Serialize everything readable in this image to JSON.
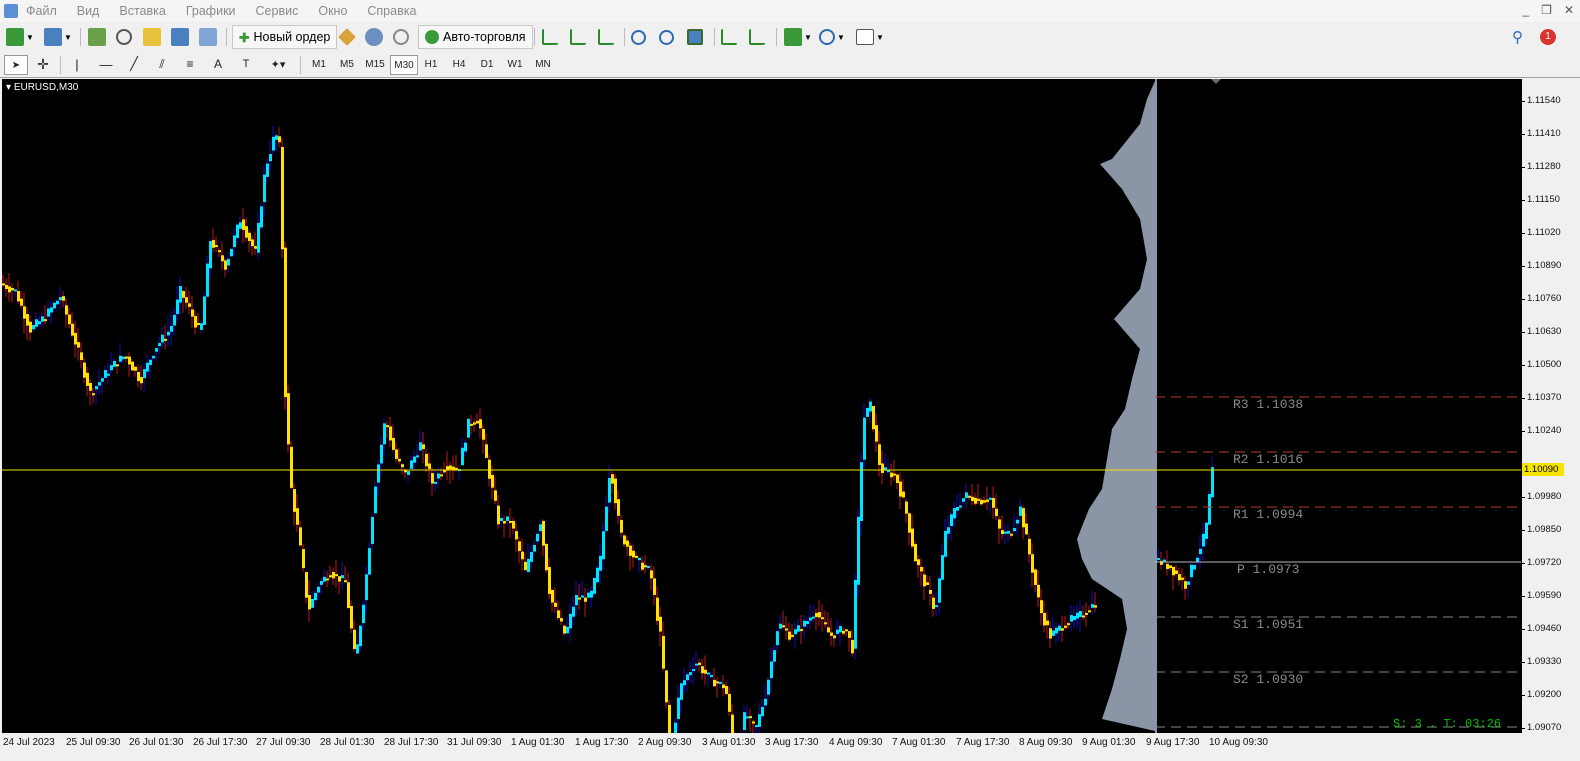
{
  "menu": [
    "Файл",
    "Вид",
    "Вставка",
    "Графики",
    "Сервис",
    "Окно",
    "Справка"
  ],
  "toolbar": {
    "new_order_label": "Новый ордер",
    "autotrade_label": "Авто-торговля",
    "notification_count": "1"
  },
  "timeframes": [
    "M1",
    "M5",
    "M15",
    "M30",
    "H1",
    "H4",
    "D1",
    "W1",
    "MN"
  ],
  "active_timeframe": "M30",
  "chart": {
    "symbol_label": "EURUSD,M30",
    "current_price": "1.10090",
    "status_text": "S: 3 . T: 03:26",
    "colors": {
      "background": "#000000",
      "up": "#00e5ff",
      "down": "#ffe000",
      "wick": "#1010c0",
      "volume_profile": "#8a96a6",
      "price_line": "#f0e000",
      "pivot_line_r": "#c0392b",
      "pivot_line_s": "#8a8a8a"
    }
  },
  "pivots": [
    {
      "name": "R3",
      "value": "1.1038",
      "label": "R3 1.1038"
    },
    {
      "name": "R2",
      "value": "1.1016",
      "label": "R2 1.1016"
    },
    {
      "name": "R1",
      "value": "1.0994",
      "label": "R1 1.0994"
    },
    {
      "name": "P",
      "value": "1.0973",
      "label": "P 1.0973"
    },
    {
      "name": "S1",
      "value": "1.0951",
      "label": "S1 1.0951"
    },
    {
      "name": "S2",
      "value": "1.0930",
      "label": "S2 1.0930"
    }
  ],
  "y_axis_labels": [
    "1.11540",
    "1.11410",
    "1.11280",
    "1.11150",
    "1.11020",
    "1.10890",
    "1.10760",
    "1.10630",
    "1.10500",
    "1.10370",
    "1.10240",
    "1.10090",
    "1.09980",
    "1.09850",
    "1.09720",
    "1.09590",
    "1.09460",
    "1.09330",
    "1.09200",
    "1.09070"
  ],
  "x_axis_labels": [
    "24 Jul 2023",
    "25 Jul 09:30",
    "26 Jul 01:30",
    "26 Jul 17:30",
    "27 Jul 09:30",
    "28 Jul 01:30",
    "28 Jul 17:30",
    "31 Jul 09:30",
    "1 Aug 01:30",
    "1 Aug 17:30",
    "2 Aug 09:30",
    "3 Aug 01:30",
    "3 Aug 17:30",
    "4 Aug 09:30",
    "7 Aug 01:30",
    "7 Aug 17:30",
    "8 Aug 09:30",
    "9 Aug 01:30",
    "9 Aug 17:30",
    "10 Aug 09:30"
  ],
  "chart_data": {
    "type": "candlestick",
    "symbol": "EURUSD",
    "timeframe": "M30",
    "ylim": [
      1.0907,
      1.1163
    ],
    "price_path": [
      [
        0,
        1.1083
      ],
      [
        15,
        1.108
      ],
      [
        30,
        1.1065
      ],
      [
        45,
        1.107
      ],
      [
        60,
        1.1078
      ],
      [
        75,
        1.106
      ],
      [
        90,
        1.104
      ],
      [
        100,
        1.1045
      ],
      [
        110,
        1.105
      ],
      [
        125,
        1.1055
      ],
      [
        140,
        1.1045
      ],
      [
        155,
        1.1058
      ],
      [
        170,
        1.1065
      ],
      [
        180,
        1.108
      ],
      [
        190,
        1.1072
      ],
      [
        200,
        1.1063
      ],
      [
        210,
        1.11
      ],
      [
        225,
        1.109
      ],
      [
        240,
        1.1108
      ],
      [
        255,
        1.1095
      ],
      [
        265,
        1.1128
      ],
      [
        275,
        1.1142
      ],
      [
        280,
        1.1135
      ],
      [
        285,
        1.104
      ],
      [
        290,
        1.1005
      ],
      [
        298,
        1.0985
      ],
      [
        308,
        1.0955
      ],
      [
        318,
        1.0965
      ],
      [
        330,
        1.097
      ],
      [
        345,
        1.0966
      ],
      [
        355,
        1.0935
      ],
      [
        365,
        1.0965
      ],
      [
        375,
        1.1005
      ],
      [
        385,
        1.103
      ],
      [
        395,
        1.1015
      ],
      [
        405,
        1.1008
      ],
      [
        420,
        1.102
      ],
      [
        432,
        1.1005
      ],
      [
        445,
        1.1012
      ],
      [
        458,
        1.101
      ],
      [
        468,
        1.1028
      ],
      [
        478,
        1.103
      ],
      [
        488,
        1.101
      ],
      [
        498,
        1.099
      ],
      [
        510,
        1.099
      ],
      [
        525,
        1.097
      ],
      [
        540,
        1.099
      ],
      [
        550,
        1.096
      ],
      [
        565,
        1.0945
      ],
      [
        575,
        1.096
      ],
      [
        590,
        1.096
      ],
      [
        600,
        1.0975
      ],
      [
        610,
        1.1012
      ],
      [
        620,
        1.0985
      ],
      [
        635,
        1.0975
      ],
      [
        650,
        1.097
      ],
      [
        660,
        1.0945
      ],
      [
        670,
        1.09
      ],
      [
        680,
        1.0925
      ],
      [
        695,
        1.0935
      ],
      [
        710,
        1.0928
      ],
      [
        725,
        1.0925
      ],
      [
        735,
        1.0898
      ],
      [
        745,
        1.0915
      ],
      [
        755,
        1.0908
      ],
      [
        765,
        1.0922
      ],
      [
        778,
        1.095
      ],
      [
        790,
        1.0945
      ],
      [
        805,
        1.095
      ],
      [
        815,
        1.0955
      ],
      [
        830,
        1.0945
      ],
      [
        845,
        1.0948
      ],
      [
        852,
        1.094
      ],
      [
        858,
        1.099
      ],
      [
        863,
        1.103
      ],
      [
        870,
        1.1035
      ],
      [
        880,
        1.101
      ],
      [
        895,
        1.1008
      ],
      [
        905,
        1.0995
      ],
      [
        915,
        1.0975
      ],
      [
        925,
        1.0965
      ],
      [
        935,
        1.0955
      ],
      [
        945,
        1.0985
      ],
      [
        955,
        1.0995
      ],
      [
        965,
        1.1
      ],
      [
        980,
        1.0998
      ],
      [
        990,
        1.0999
      ],
      [
        1000,
        1.0985
      ],
      [
        1010,
        1.0985
      ],
      [
        1020,
        1.0995
      ],
      [
        1030,
        1.0975
      ],
      [
        1040,
        1.0955
      ],
      [
        1050,
        1.0945
      ],
      [
        1065,
        1.095
      ],
      [
        1080,
        1.0953
      ],
      [
        1095,
        1.0958
      ],
      [
        1155,
        1.0975
      ],
      [
        1170,
        1.0972
      ],
      [
        1185,
        1.0965
      ],
      [
        1195,
        1.0975
      ],
      [
        1205,
        1.0985
      ],
      [
        1212,
        1.101
      ]
    ]
  }
}
